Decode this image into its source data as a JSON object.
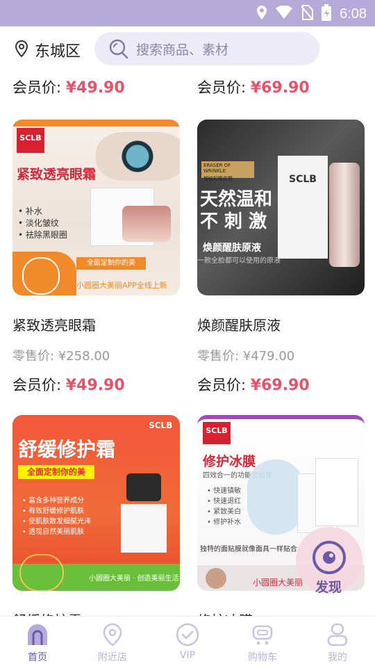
{
  "status_bar": {
    "time": "6:08"
  },
  "header": {
    "location": "东城区",
    "search_placeholder": "搜索商品、素材"
  },
  "top_row": [
    {
      "member_label": "会员价:",
      "member_price": "¥49.90"
    },
    {
      "member_label": "会员价:",
      "member_price": "¥69.90"
    }
  ],
  "products": [
    {
      "name": "紧致透亮眼霜",
      "retail_label": "零售价:",
      "retail_price": "¥258.00",
      "member_label": "会员价:",
      "member_price": "¥49.90",
      "banner": {
        "logo": "SCLB",
        "headline": "紧致透亮眼霜",
        "bullets": [
          "• 补水",
          "• 淡化皱纹",
          "• 祛除黑眼圈"
        ],
        "tagline": "全面定制你的美",
        "footer": "小圆圈大美丽APP全线上新"
      }
    },
    {
      "name": "焕颜醒肤原液",
      "retail_label": "零售价:",
      "retail_price": "¥479.00",
      "member_label": "会员价:",
      "member_price": "¥69.90",
      "banner": {
        "logo": "SCLB",
        "eraser": "ERASER OF WRINKLE",
        "eraser_cn": "皱纹的橡皮擦",
        "headline1": "天然温和",
        "headline2": "不 刺 激",
        "subtitle": "焕颜醒肤原液",
        "caption": "一款全脸都可以使用的原液"
      }
    },
    {
      "name": "舒缓修护霜",
      "banner": {
        "logo": "SCLB",
        "headline": "舒缓修护霜",
        "tagline": "全面定制你的美",
        "bullets": [
          "• 富含多种营养成分",
          "• 有效舒缓修护肌肤",
          "• 使肌肤散发细腻光泽",
          "• 透现自然美丽肌肤"
        ],
        "footer": "小圆圈大美丽 · 创造美丽生活"
      }
    },
    {
      "name": "修护冰膜",
      "banner": {
        "logo": "SCLB",
        "headline": "修护冰膜",
        "subtitle": "四效合一的功能型面膜",
        "bullets": [
          "• 快速镇敏",
          "• 快速退红",
          "• 紧致美白",
          "• 修护补水"
        ],
        "caption": "独特的面贴膜就像面具一样贴合",
        "footer": "小圆圈大美丽"
      }
    }
  ],
  "fab": {
    "label": "发现"
  },
  "tabs": [
    {
      "label": "首页",
      "icon": "home-icon",
      "active": true
    },
    {
      "label": "附近店",
      "icon": "nearby-store-icon",
      "active": false
    },
    {
      "label": "VIP",
      "icon": "vip-icon",
      "active": false
    },
    {
      "label": "购物车",
      "icon": "cart-icon",
      "active": false
    },
    {
      "label": "我的",
      "icon": "profile-icon",
      "active": false
    }
  ],
  "colors": {
    "accent": "#6a5aa8",
    "price": "#e2546a",
    "status_bar": "#b5aad8",
    "search_bg": "#ecebf7"
  }
}
